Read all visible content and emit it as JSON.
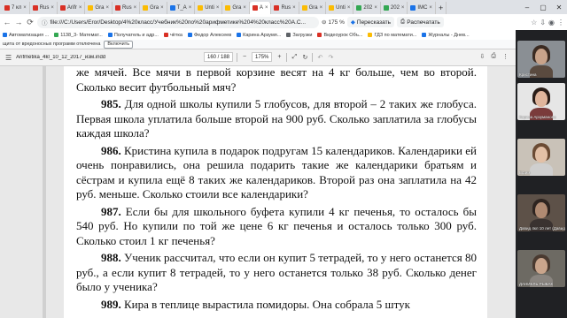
{
  "tabs": [
    {
      "label": "7 кл",
      "color": "#d93025",
      "active": false
    },
    {
      "label": "Rus",
      "color": "#d93025",
      "active": false
    },
    {
      "label": "Arifr",
      "color": "#d93025",
      "active": false
    },
    {
      "label": "Gra",
      "color": "#fbbc04",
      "active": false
    },
    {
      "label": "Rus",
      "color": "#d93025",
      "active": false
    },
    {
      "label": "Gra",
      "color": "#fbbc04",
      "active": false
    },
    {
      "label": "T_A",
      "color": "#1a73e8",
      "active": false
    },
    {
      "label": "Unti",
      "color": "#fbbc04",
      "active": false
    },
    {
      "label": "Gra",
      "color": "#fbbc04",
      "active": false
    },
    {
      "label": "A",
      "color": "#d93025",
      "active": true
    },
    {
      "label": "Rus",
      "color": "#d93025",
      "active": false
    },
    {
      "label": "Gra",
      "color": "#fbbc04",
      "active": false
    },
    {
      "label": "Unti",
      "color": "#fbbc04",
      "active": false
    },
    {
      "label": "202",
      "color": "#34a853",
      "active": false
    },
    {
      "label": "202",
      "color": "#34a853",
      "active": false
    },
    {
      "label": "IMC",
      "color": "#1a73e8",
      "active": false
    }
  ],
  "address": {
    "url": "file:///C:/Users/Eror/Desktop/4%20класс/Учебник%20по%20арифметике%204%20класс%20A.C...",
    "zoom": "175 %",
    "translate": "Пересказать",
    "print": "Распечатать"
  },
  "bookmarks": [
    {
      "label": "Автоматизация ...",
      "color": "#1a73e8"
    },
    {
      "label": "1138_3- Математ...",
      "color": "#34a853"
    },
    {
      "label": "Получатель и адр...",
      "color": "#1a73e8"
    },
    {
      "label": "чётка",
      "color": "#d93025"
    },
    {
      "label": "Федор Алексеев",
      "color": "#1a73e8"
    },
    {
      "label": "Карина Арзумя...",
      "color": "#1a73e8"
    },
    {
      "label": "Загрузки",
      "color": "#5f6368"
    },
    {
      "label": "Видеоурок Объ...",
      "color": "#d93025"
    },
    {
      "label": "ГДЗ по математи...",
      "color": "#fbbc04"
    },
    {
      "label": "Журналы - Днев...",
      "color": "#1a73e8"
    }
  ],
  "infobar": {
    "text": "щита от вредоносных программ отключена",
    "button": "Включить"
  },
  "pdf": {
    "filename": "Arifmetika_4kl_10_12_2017_изм.indd",
    "page": "160 / 188",
    "zoom": "175%",
    "minus": "−",
    "plus": "+"
  },
  "problems": [
    {
      "num": "",
      "text": "же мячей. Все мячи в первой корзине весят на 4 кг больше, чем во второй. Сколько весит футбольный мяч?",
      "cont": true
    },
    {
      "num": "985.",
      "text": "Для одной школы купили 5 глобусов, для второй – 2 таких же глобуса. Первая школа уплатила больше второй на 900 руб. Сколько заплатила за глобусы каждая школа?",
      "cont": false
    },
    {
      "num": "986.",
      "text": "Кристина купила в подарок подругам 15 календариков. Календарики ей очень понравились, она решила подарить такие же календарики братьям и сёстрам и купила ещё 8 таких же календариков. Второй раз она заплатила на 42 руб. меньше. Сколько стоили все календарики?",
      "cont": false
    },
    {
      "num": "987.",
      "text": "Если бы для школьного буфета купили 4 кг печенья, то осталось бы 540 руб. Но купили по той же цене 6 кг печенья и осталось только 300 руб. Сколько стоил 1 кг печенья?",
      "cont": false
    },
    {
      "num": "988.",
      "text": "Ученик рассчитал, что если он купит 5 тетрадей, то у него останется 80 руб., а если купит 8 тетрадей, то у него останется только 38 руб. Сколько денег было у ученика?",
      "cont": false
    },
    {
      "num": "989.",
      "text": "Кира в теплице вырастила помидоры. Она собрала 5 штук",
      "cont": false
    }
  ],
  "participants": [
    {
      "name": "Кристина",
      "bg": "#8a8f94"
    },
    {
      "name": "Карина Арзуманова",
      "bg": "#e6e6e6"
    },
    {
      "name": "Ефим",
      "bg": "#c9c2b8"
    },
    {
      "name": "Давид 4кл 10 лет (Давид...",
      "bg": "#5d5148"
    },
    {
      "name": "ДАНИЕЛЬ РЫБАК",
      "bg": "#6d6a63"
    }
  ]
}
